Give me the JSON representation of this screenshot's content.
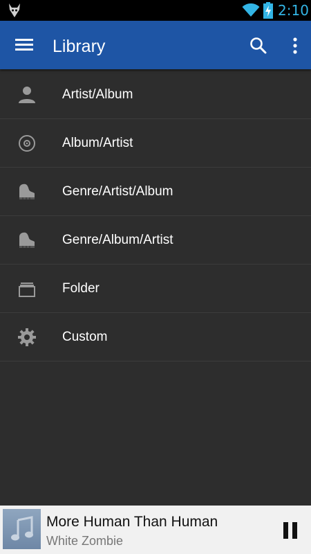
{
  "status_bar": {
    "time": "2:10",
    "icons": [
      "app-notification-icon",
      "wifi-icon",
      "battery-charging-icon"
    ],
    "accent": "#33b5e5"
  },
  "toolbar": {
    "title": "Library",
    "background": "#1e55a5",
    "icons": [
      "menu-icon",
      "search-icon",
      "overflow-menu-icon"
    ]
  },
  "library": {
    "items": [
      {
        "label": "Artist/Album",
        "icon": "person-icon"
      },
      {
        "label": "Album/Artist",
        "icon": "disc-icon"
      },
      {
        "label": "Genre/Artist/Album",
        "icon": "piano-icon"
      },
      {
        "label": "Genre/Album/Artist",
        "icon": "piano-icon"
      },
      {
        "label": "Folder",
        "icon": "folder-icon"
      },
      {
        "label": "Custom",
        "icon": "gear-icon"
      }
    ]
  },
  "now_playing": {
    "track": "More Human Than Human",
    "artist": "White Zombie",
    "art_icon": "music-note-icon",
    "control_icon": "pause-icon"
  }
}
